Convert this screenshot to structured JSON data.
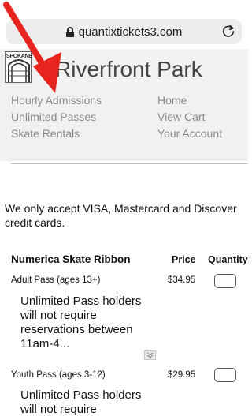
{
  "browser": {
    "url": "quantixtickets3.com"
  },
  "header": {
    "logo_text": "SPOKANE",
    "site_title": "Riverfront Park"
  },
  "nav": {
    "left": [
      "Hourly Admissions",
      "Unlimited Passes",
      "Skate Rentals"
    ],
    "right": [
      "Home",
      "View Cart",
      "Your Account"
    ]
  },
  "notice": "We only accept VISA, Mastercard and Discover credit cards.",
  "product": {
    "title": "Numerica Skate Ribbon",
    "col_price": "Price",
    "col_quantity": "Quantity",
    "rows": [
      {
        "label": "Adult Pass (ages 13+)",
        "price": "$34.95",
        "quantity": "",
        "description": "Unlimited Pass holders will not require reservations between 11am-4..."
      },
      {
        "label": "Youth Pass (ages 3-12)",
        "price": "$29.95",
        "quantity": "",
        "description": "Unlimited Pass holders will not require"
      }
    ]
  },
  "colors": {
    "annotation_arrow": "#e8241e",
    "header_bg": "#f1f1f1",
    "nav_text": "#8a8a8a"
  }
}
